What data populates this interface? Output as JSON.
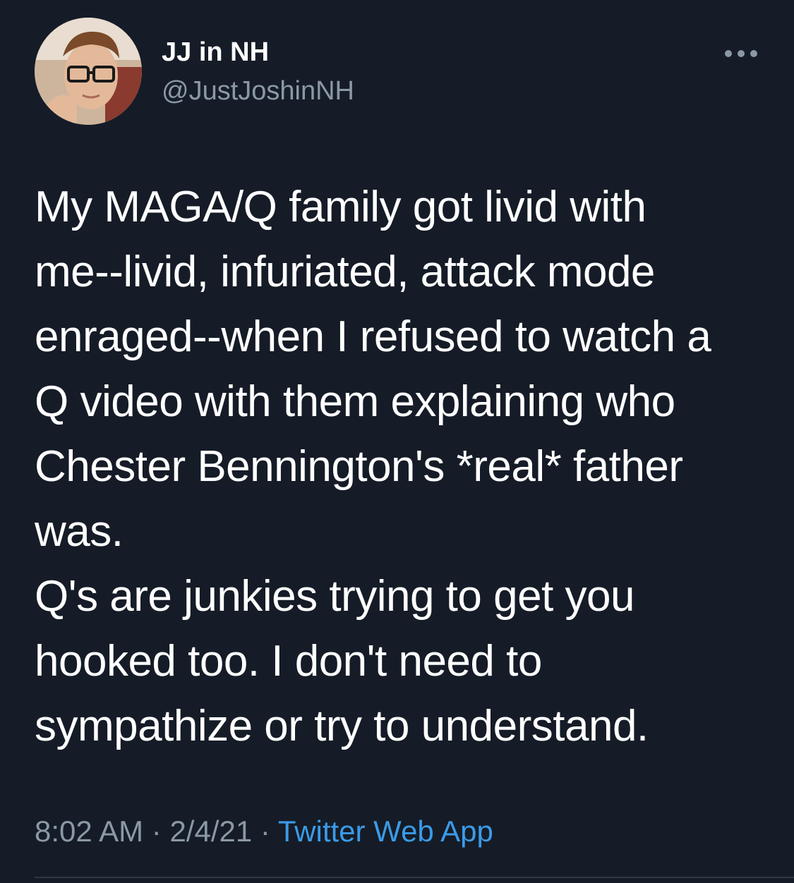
{
  "author": {
    "display_name": "JJ in NH",
    "handle": "@JustJoshinNH",
    "avatar_icon": "avatar"
  },
  "more_icon": "more-horizontal-icon",
  "tweet": {
    "text": "My MAGA/Q family got livid with\nme--livid, infuriated, attack mode\nenraged--when I refused to watch a\nQ video with them explaining who\nChester Bennington's *real* father\nwas.\nQ's are junkies trying to get you\nhooked too. I don't need to\nsympathize or try to understand.",
    "time": "8:02 AM",
    "separator": "·",
    "date": "2/4/21",
    "source": "Twitter Web App"
  },
  "colors": {
    "background": "#151c27",
    "text": "#ffffff",
    "secondary_text": "#8b98a5",
    "link": "#3b9be8"
  }
}
